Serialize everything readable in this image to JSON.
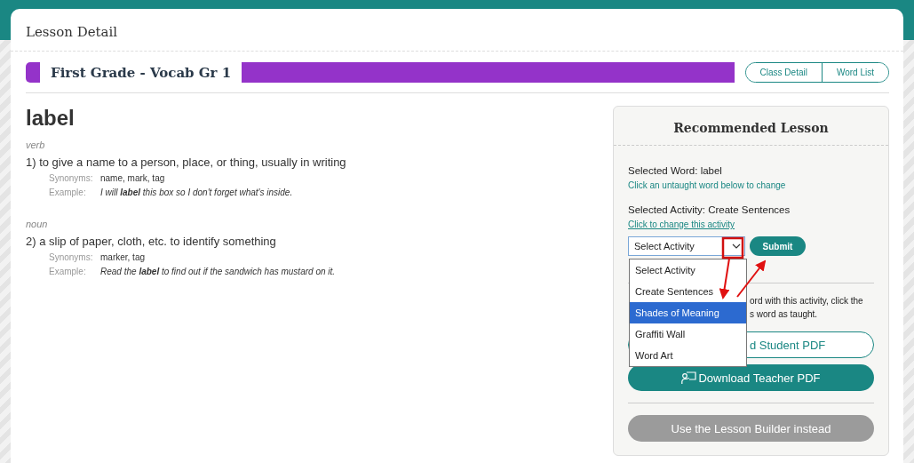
{
  "page": {
    "title": "Lesson Detail"
  },
  "lesson_bar": {
    "title": "First Grade - Vocab Gr 1",
    "buttons": [
      "Class Detail",
      "Word List"
    ]
  },
  "word": {
    "term": "label",
    "senses": [
      {
        "part_of_speech": "verb",
        "definition": "1) to give a name to a person, place, or thing, usually in writing",
        "synonyms_label": "Synonyms:",
        "synonyms": "name, mark, tag",
        "example_label": "Example:",
        "example": "I will **label** this box so I don't forget what's inside."
      },
      {
        "part_of_speech": "noun",
        "definition": "2) a slip of paper, cloth, etc. to identify something",
        "synonyms_label": "Synonyms:",
        "synonyms": "marker, tag",
        "example_label": "Example:",
        "example": "Read the **label** to find out if the sandwich has mustard on it."
      }
    ]
  },
  "panel": {
    "title": "Recommended Lesson",
    "selected_word_label": "Selected Word:",
    "selected_word": "label",
    "word_hint": "Click an untaught word below to change",
    "selected_activity_label": "Selected Activity:",
    "selected_activity": "Create Sentences",
    "change_link": "Click to change this activity",
    "select": {
      "value": "Select Activity",
      "expanded": true,
      "options": [
        {
          "label": "Select Activity",
          "highlighted": false
        },
        {
          "label": "Create Sentences",
          "highlighted": false
        },
        {
          "label": "Shades of Meaning",
          "highlighted": true
        },
        {
          "label": "Graffiti Wall",
          "highlighted": false
        },
        {
          "label": "Word Art",
          "highlighted": false
        }
      ]
    },
    "submit": "Submit",
    "note_lines": [
      "ord with this activity, click the",
      "s word as taught."
    ],
    "student_pdf": "d Student PDF",
    "teacher_pdf": "Download Teacher PDF",
    "builder": "Use the Lesson Builder instead"
  }
}
